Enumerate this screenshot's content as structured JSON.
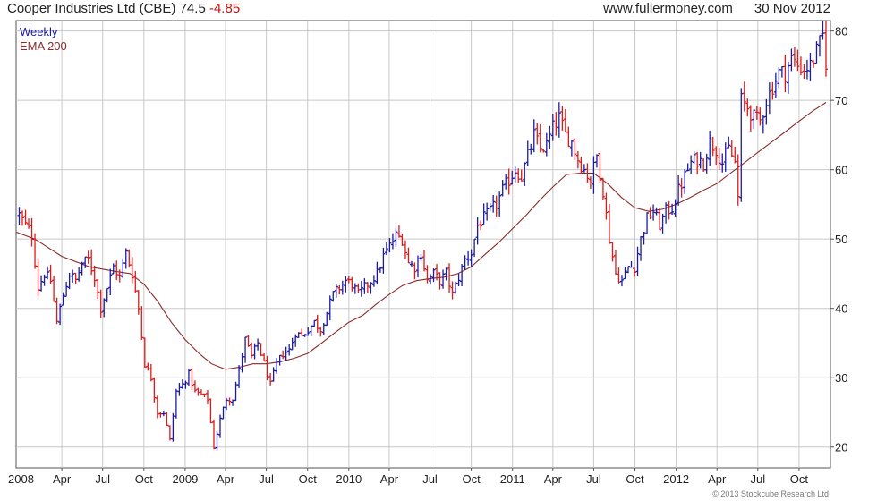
{
  "header": {
    "name": "Cooper Industries Ltd (CBE)",
    "last": "74.5",
    "change": "-4.85",
    "source": "www.fullermoney.com",
    "date": "30 Nov 2012"
  },
  "credit": "© 2013 Stockcube Research Ltd",
  "colors": {
    "up": "#1a1aa6",
    "down": "#e01818",
    "ema": "#8b2a2a",
    "grid": "#c8c8c8"
  },
  "chart_data": {
    "type": "line",
    "title": "Cooper Industries Ltd (CBE)",
    "legend": [
      "Weekly",
      "EMA 200"
    ],
    "legend_position": "top-left",
    "grid": true,
    "xlabel": "",
    "ylabel": "",
    "ylim": [
      17,
      81.5
    ],
    "y_ticks": [
      20,
      30,
      40,
      50,
      60,
      70,
      80
    ],
    "x_tick_labels": [
      "2008",
      "Apr",
      "Jul",
      "Oct",
      "2009",
      "Apr",
      "Jul",
      "Oct",
      "2010",
      "Apr",
      "Jul",
      "Oct",
      "2011",
      "Apr",
      "Jul",
      "Oct",
      "2012",
      "Apr",
      "Jul",
      "Oct"
    ],
    "x_tick_dates": [
      "2008-01-01",
      "2008-04-01",
      "2008-07-01",
      "2008-10-01",
      "2009-01-01",
      "2009-04-01",
      "2009-07-01",
      "2009-10-01",
      "2010-01-01",
      "2010-04-01",
      "2010-07-01",
      "2010-10-01",
      "2011-01-01",
      "2011-04-01",
      "2011-07-01",
      "2011-10-01",
      "2012-01-01",
      "2012-04-01",
      "2012-07-01",
      "2012-10-01"
    ],
    "x_range": [
      "2007-12-21",
      "2012-12-10"
    ],
    "series": [
      {
        "name": "Weekly",
        "kind": "price",
        "points": [
          [
            "2007-12-28",
            53.5
          ],
          [
            "2008-01-25",
            50.5
          ],
          [
            "2008-02-08",
            43.0
          ],
          [
            "2008-02-22",
            45.0
          ],
          [
            "2008-03-07",
            44.0
          ],
          [
            "2008-03-21",
            38.0
          ],
          [
            "2008-04-04",
            42.0
          ],
          [
            "2008-04-18",
            45.0
          ],
          [
            "2008-05-02",
            44.0
          ],
          [
            "2008-05-16",
            46.5
          ],
          [
            "2008-05-30",
            47.0
          ],
          [
            "2008-06-13",
            44.5
          ],
          [
            "2008-06-27",
            40.0
          ],
          [
            "2008-07-11",
            43.0
          ],
          [
            "2008-07-25",
            46.0
          ],
          [
            "2008-08-08",
            44.5
          ],
          [
            "2008-08-22",
            48.0
          ],
          [
            "2008-09-05",
            45.0
          ],
          [
            "2008-09-19",
            40.0
          ],
          [
            "2008-10-03",
            32.0
          ],
          [
            "2008-10-17",
            30.0
          ],
          [
            "2008-10-31",
            25.0
          ],
          [
            "2008-11-14",
            25.0
          ],
          [
            "2008-11-28",
            21.0
          ],
          [
            "2008-12-12",
            28.0
          ],
          [
            "2008-12-26",
            29.0
          ],
          [
            "2009-01-09",
            30.5
          ],
          [
            "2009-01-23",
            28.0
          ],
          [
            "2009-02-06",
            27.5
          ],
          [
            "2009-02-20",
            27.0
          ],
          [
            "2009-03-06",
            20.0
          ],
          [
            "2009-03-20",
            24.0
          ],
          [
            "2009-04-03",
            27.0
          ],
          [
            "2009-04-17",
            27.0
          ],
          [
            "2009-05-01",
            31.0
          ],
          [
            "2009-05-15",
            35.5
          ],
          [
            "2009-05-29",
            33.0
          ],
          [
            "2009-06-12",
            35.0
          ],
          [
            "2009-06-26",
            32.0
          ],
          [
            "2009-07-10",
            29.0
          ],
          [
            "2009-07-24",
            32.0
          ],
          [
            "2009-08-07",
            33.5
          ],
          [
            "2009-08-21",
            34.0
          ],
          [
            "2009-09-04",
            36.5
          ],
          [
            "2009-09-18",
            36.0
          ],
          [
            "2009-10-02",
            37.0
          ],
          [
            "2009-10-16",
            38.0
          ],
          [
            "2009-10-30",
            37.0
          ],
          [
            "2009-11-13",
            39.5
          ],
          [
            "2009-11-27",
            42.0
          ],
          [
            "2009-12-11",
            43.0
          ],
          [
            "2009-12-25",
            44.0
          ],
          [
            "2010-01-08",
            43.5
          ],
          [
            "2010-01-22",
            42.0
          ],
          [
            "2010-02-05",
            43.0
          ],
          [
            "2010-02-19",
            44.0
          ],
          [
            "2010-03-05",
            45.0
          ],
          [
            "2010-03-19",
            47.5
          ],
          [
            "2010-04-02",
            49.0
          ],
          [
            "2010-04-16",
            50.5
          ],
          [
            "2010-04-30",
            50.0
          ],
          [
            "2010-05-14",
            46.5
          ],
          [
            "2010-05-28",
            46.0
          ],
          [
            "2010-06-11",
            48.0
          ],
          [
            "2010-06-25",
            44.0
          ],
          [
            "2010-07-09",
            45.0
          ],
          [
            "2010-07-23",
            44.0
          ],
          [
            "2010-08-06",
            45.0
          ],
          [
            "2010-08-20",
            42.0
          ],
          [
            "2010-09-03",
            44.5
          ],
          [
            "2010-09-17",
            47.0
          ],
          [
            "2010-10-01",
            48.0
          ],
          [
            "2010-10-15",
            52.0
          ],
          [
            "2010-10-29",
            53.0
          ],
          [
            "2010-11-12",
            54.0
          ],
          [
            "2010-11-26",
            55.0
          ],
          [
            "2010-12-10",
            57.0
          ],
          [
            "2010-12-24",
            58.5
          ],
          [
            "2011-01-07",
            60.0
          ],
          [
            "2011-01-21",
            59.0
          ],
          [
            "2011-02-04",
            62.0
          ],
          [
            "2011-02-18",
            65.0
          ],
          [
            "2011-03-04",
            63.0
          ],
          [
            "2011-03-18",
            63.5
          ],
          [
            "2011-04-01",
            66.0
          ],
          [
            "2011-04-15",
            67.5
          ],
          [
            "2011-04-29",
            65.0
          ],
          [
            "2011-05-13",
            64.0
          ],
          [
            "2011-05-27",
            61.5
          ],
          [
            "2011-06-10",
            60.0
          ],
          [
            "2011-06-24",
            58.5
          ],
          [
            "2011-07-08",
            62.0
          ],
          [
            "2011-07-22",
            57.0
          ],
          [
            "2011-08-05",
            50.0
          ],
          [
            "2011-08-19",
            45.0
          ],
          [
            "2011-09-02",
            44.0
          ],
          [
            "2011-09-16",
            46.0
          ],
          [
            "2011-09-30",
            46.0
          ],
          [
            "2011-10-14",
            50.0
          ],
          [
            "2011-10-28",
            53.0
          ],
          [
            "2011-11-11",
            54.0
          ],
          [
            "2011-11-25",
            52.0
          ],
          [
            "2011-12-09",
            54.0
          ],
          [
            "2011-12-23",
            54.5
          ],
          [
            "2012-01-06",
            57.0
          ],
          [
            "2012-01-20",
            59.0
          ],
          [
            "2012-02-03",
            61.0
          ],
          [
            "2012-02-17",
            61.5
          ],
          [
            "2012-03-02",
            61.0
          ],
          [
            "2012-03-16",
            64.0
          ],
          [
            "2012-03-30",
            63.0
          ],
          [
            "2012-04-13",
            61.0
          ],
          [
            "2012-04-27",
            63.0
          ],
          [
            "2012-05-11",
            61.0
          ],
          [
            "2012-05-18",
            56.0
          ],
          [
            "2012-05-25",
            70.0
          ],
          [
            "2012-06-08",
            69.0
          ],
          [
            "2012-06-22",
            67.5
          ],
          [
            "2012-07-06",
            67.0
          ],
          [
            "2012-07-20",
            70.0
          ],
          [
            "2012-08-03",
            72.0
          ],
          [
            "2012-08-17",
            74.0
          ],
          [
            "2012-08-31",
            74.0
          ],
          [
            "2012-09-14",
            76.0
          ],
          [
            "2012-09-28",
            75.0
          ],
          [
            "2012-10-12",
            74.5
          ],
          [
            "2012-10-26",
            75.0
          ],
          [
            "2012-11-09",
            77.0
          ],
          [
            "2012-11-23",
            79.3
          ],
          [
            "2012-11-30",
            74.5
          ]
        ]
      },
      {
        "name": "EMA 200",
        "kind": "line",
        "points": [
          [
            "2007-12-21",
            51.0
          ],
          [
            "2008-02-01",
            50.0
          ],
          [
            "2008-04-01",
            47.5
          ],
          [
            "2008-06-01",
            46.0
          ],
          [
            "2008-08-01",
            45.3
          ],
          [
            "2008-09-01",
            45.0
          ],
          [
            "2008-10-01",
            43.5
          ],
          [
            "2008-11-01",
            41.0
          ],
          [
            "2008-12-01",
            38.0
          ],
          [
            "2009-01-01",
            35.5
          ],
          [
            "2009-02-01",
            33.5
          ],
          [
            "2009-03-01",
            32.0
          ],
          [
            "2009-04-01",
            31.2
          ],
          [
            "2009-05-01",
            31.5
          ],
          [
            "2009-06-01",
            32.0
          ],
          [
            "2009-07-01",
            32.0
          ],
          [
            "2009-08-01",
            32.3
          ],
          [
            "2009-09-01",
            32.8
          ],
          [
            "2009-10-01",
            33.5
          ],
          [
            "2009-11-01",
            35.0
          ],
          [
            "2009-12-01",
            36.5
          ],
          [
            "2010-01-01",
            38.0
          ],
          [
            "2010-02-01",
            39.0
          ],
          [
            "2010-03-01",
            40.5
          ],
          [
            "2010-04-01",
            42.0
          ],
          [
            "2010-05-01",
            43.3
          ],
          [
            "2010-06-01",
            44.0
          ],
          [
            "2010-07-01",
            44.3
          ],
          [
            "2010-08-01",
            44.5
          ],
          [
            "2010-09-01",
            45.0
          ],
          [
            "2010-10-01",
            46.0
          ],
          [
            "2010-11-01",
            47.8
          ],
          [
            "2010-12-01",
            49.5
          ],
          [
            "2011-01-01",
            51.5
          ],
          [
            "2011-02-01",
            53.5
          ],
          [
            "2011-03-01",
            55.5
          ],
          [
            "2011-04-01",
            57.5
          ],
          [
            "2011-05-01",
            59.3
          ],
          [
            "2011-06-01",
            59.5
          ],
          [
            "2011-07-01",
            59.5
          ],
          [
            "2011-08-01",
            58.0
          ],
          [
            "2011-09-01",
            56.0
          ],
          [
            "2011-10-01",
            54.5
          ],
          [
            "2011-11-01",
            54.0
          ],
          [
            "2011-12-01",
            54.3
          ],
          [
            "2012-01-01",
            55.0
          ],
          [
            "2012-02-01",
            56.0
          ],
          [
            "2012-03-01",
            57.0
          ],
          [
            "2012-04-01",
            58.0
          ],
          [
            "2012-05-01",
            59.5
          ],
          [
            "2012-06-01",
            61.0
          ],
          [
            "2012-07-01",
            62.5
          ],
          [
            "2012-08-01",
            64.0
          ],
          [
            "2012-09-01",
            65.5
          ],
          [
            "2012-10-01",
            67.0
          ],
          [
            "2012-11-01",
            68.5
          ],
          [
            "2012-11-30",
            69.7
          ]
        ]
      }
    ]
  }
}
